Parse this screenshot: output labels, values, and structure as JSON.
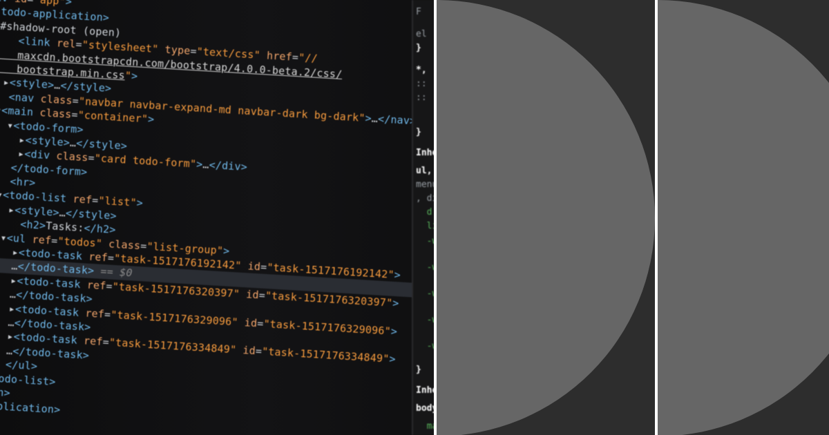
{
  "code_lines": [
    {
      "parts": [
        {
          "c": "t",
          "s": "iv "
        },
        {
          "c": "a",
          "s": "id"
        },
        {
          "c": "p",
          "s": "="
        },
        {
          "c": "v",
          "s": "\"app\""
        },
        {
          "c": "t",
          "s": ">"
        }
      ]
    },
    {
      "parts": [
        {
          "c": "t",
          "s": " todo-application>"
        }
      ]
    },
    {
      "parts": [
        {
          "c": "p",
          "s": "▾#shadow-root (open)"
        }
      ]
    },
    {
      "parts": [
        {
          "c": "t",
          "s": "    <link "
        },
        {
          "c": "a",
          "s": "rel"
        },
        {
          "c": "p",
          "s": "="
        },
        {
          "c": "v",
          "s": "\"stylesheet\""
        },
        {
          "c": "a",
          "s": " type"
        },
        {
          "c": "p",
          "s": "="
        },
        {
          "c": "v",
          "s": "\"text/css\""
        },
        {
          "c": "a",
          "s": " href"
        },
        {
          "c": "p",
          "s": "="
        },
        {
          "c": "v",
          "s": "\"//"
        }
      ]
    },
    {
      "parts": [
        {
          "c": "u",
          "s": "    maxcdn.bootstrapcdn.com/bootstrap/4.0.0-beta.2/css/"
        }
      ]
    },
    {
      "parts": [
        {
          "c": "u",
          "s": "    bootstrap.min.css"
        },
        {
          "c": "v",
          "s": "\""
        },
        {
          "c": "t",
          "s": ">"
        }
      ]
    },
    {
      "parts": [
        {
          "c": "p",
          "s": "  ▸"
        },
        {
          "c": "t",
          "s": "<style>"
        },
        {
          "c": "p",
          "s": "…"
        },
        {
          "c": "t",
          "s": "</style>"
        }
      ]
    },
    {
      "parts": [
        {
          "c": "t",
          "s": "   <nav "
        },
        {
          "c": "a",
          "s": "class"
        },
        {
          "c": "p",
          "s": "="
        },
        {
          "c": "v",
          "s": "\"navbar navbar-expand-md navbar-dark bg-dark\""
        },
        {
          "c": "t",
          "s": ">"
        },
        {
          "c": "p",
          "s": "…"
        },
        {
          "c": "t",
          "s": "</nav>"
        }
      ]
    },
    {
      "parts": [
        {
          "c": "p",
          "s": " ▾"
        },
        {
          "c": "t",
          "s": "<main "
        },
        {
          "c": "a",
          "s": "class"
        },
        {
          "c": "p",
          "s": "="
        },
        {
          "c": "v",
          "s": "\"container\""
        },
        {
          "c": "t",
          "s": ">"
        }
      ]
    },
    {
      "parts": [
        {
          "c": "p",
          "s": "   ▾"
        },
        {
          "c": "t",
          "s": "<todo-form>"
        }
      ]
    },
    {
      "parts": [
        {
          "c": "p",
          "s": "     ▸"
        },
        {
          "c": "t",
          "s": "<style>"
        },
        {
          "c": "p",
          "s": "…"
        },
        {
          "c": "t",
          "s": "</style>"
        }
      ]
    },
    {
      "parts": [
        {
          "c": "p",
          "s": "     ▸"
        },
        {
          "c": "t",
          "s": "<div "
        },
        {
          "c": "a",
          "s": "class"
        },
        {
          "c": "p",
          "s": "="
        },
        {
          "c": "v",
          "s": "\"card todo-form\""
        },
        {
          "c": "t",
          "s": ">"
        },
        {
          "c": "p",
          "s": "…"
        },
        {
          "c": "t",
          "s": "</div>"
        }
      ]
    },
    {
      "parts": [
        {
          "c": "t",
          "s": "    </todo-form>"
        }
      ]
    },
    {
      "parts": [
        {
          "c": "t",
          "s": "    <hr>"
        }
      ]
    },
    {
      "parts": [
        {
          "c": "p",
          "s": "  ▾"
        },
        {
          "c": "t",
          "s": "<todo-list "
        },
        {
          "c": "a",
          "s": "ref"
        },
        {
          "c": "p",
          "s": "="
        },
        {
          "c": "v",
          "s": "\"list\""
        },
        {
          "c": "t",
          "s": ">"
        }
      ]
    },
    {
      "parts": [
        {
          "c": "p",
          "s": "    ▸"
        },
        {
          "c": "t",
          "s": "<style>"
        },
        {
          "c": "p",
          "s": "…"
        },
        {
          "c": "t",
          "s": "</style>"
        }
      ]
    },
    {
      "parts": [
        {
          "c": "t",
          "s": "      <h2>"
        },
        {
          "c": "p",
          "s": "Tasks:"
        },
        {
          "c": "t",
          "s": "</h2>"
        }
      ]
    },
    {
      "parts": [
        {
          "c": "p",
          "s": "   ▾"
        },
        {
          "c": "t",
          "s": "<ul "
        },
        {
          "c": "a",
          "s": "ref"
        },
        {
          "c": "p",
          "s": "="
        },
        {
          "c": "v",
          "s": "\"todos\""
        },
        {
          "c": "a",
          "s": " class"
        },
        {
          "c": "p",
          "s": "="
        },
        {
          "c": "v",
          "s": "\"list-group\""
        },
        {
          "c": "t",
          "s": ">"
        }
      ]
    },
    {
      "parts": [
        {
          "c": "p",
          "s": "     ▸"
        },
        {
          "c": "t",
          "s": "<todo-task "
        },
        {
          "c": "a",
          "s": "ref"
        },
        {
          "c": "p",
          "s": "="
        },
        {
          "c": "v",
          "s": "\"task-1517176192142\""
        },
        {
          "c": "a",
          "s": " id"
        },
        {
          "c": "p",
          "s": "="
        },
        {
          "c": "v",
          "s": "\"task-1517176192142\""
        },
        {
          "c": "t",
          "s": ">"
        }
      ]
    },
    {
      "sel": true,
      "parts": [
        {
          "c": "p",
          "s": "     …"
        },
        {
          "c": "t",
          "s": "</todo-task>"
        },
        {
          "c": "c",
          "s": " == $0"
        }
      ]
    },
    {
      "parts": [
        {
          "c": "p",
          "s": "     ▸"
        },
        {
          "c": "t",
          "s": "<todo-task "
        },
        {
          "c": "a",
          "s": "ref"
        },
        {
          "c": "p",
          "s": "="
        },
        {
          "c": "v",
          "s": "\"task-1517176320397\""
        },
        {
          "c": "a",
          "s": " id"
        },
        {
          "c": "p",
          "s": "="
        },
        {
          "c": "v",
          "s": "\"task-1517176320397\""
        },
        {
          "c": "t",
          "s": ">"
        }
      ]
    },
    {
      "parts": [
        {
          "c": "p",
          "s": "     …"
        },
        {
          "c": "t",
          "s": "</todo-task>"
        }
      ]
    },
    {
      "parts": [
        {
          "c": "p",
          "s": "     ▸"
        },
        {
          "c": "t",
          "s": "<todo-task "
        },
        {
          "c": "a",
          "s": "ref"
        },
        {
          "c": "p",
          "s": "="
        },
        {
          "c": "v",
          "s": "\"task-1517176329096\""
        },
        {
          "c": "a",
          "s": " id"
        },
        {
          "c": "p",
          "s": "="
        },
        {
          "c": "v",
          "s": "\"task-1517176329096\""
        },
        {
          "c": "t",
          "s": ">"
        }
      ]
    },
    {
      "parts": [
        {
          "c": "p",
          "s": "     …"
        },
        {
          "c": "t",
          "s": "</todo-task>"
        }
      ]
    },
    {
      "parts": [
        {
          "c": "p",
          "s": "     ▸"
        },
        {
          "c": "t",
          "s": "<todo-task "
        },
        {
          "c": "a",
          "s": "ref"
        },
        {
          "c": "p",
          "s": "="
        },
        {
          "c": "v",
          "s": "\"task-1517176334849\""
        },
        {
          "c": "a",
          "s": " id"
        },
        {
          "c": "p",
          "s": "="
        },
        {
          "c": "v",
          "s": "\"task-1517176334849\""
        },
        {
          "c": "t",
          "s": ">"
        }
      ]
    },
    {
      "parts": [
        {
          "c": "p",
          "s": "     …"
        },
        {
          "c": "t",
          "s": "</todo-task>"
        }
      ]
    },
    {
      "parts": [
        {
          "c": "t",
          "s": "     </ul>"
        }
      ]
    },
    {
      "parts": [
        {
          "c": "t",
          "s": "    odo-list>"
        }
      ]
    },
    {
      "parts": [
        {
          "c": "t",
          "s": "    n>"
        }
      ]
    },
    {
      "parts": [
        {
          "c": "t",
          "s": "    plication>"
        }
      ]
    }
  ],
  "side_panel": [
    {
      "cls": "",
      "text": "F"
    },
    {
      "cls": "",
      "text": "el"
    },
    {
      "cls": "w",
      "text": "}"
    },
    {
      "cls": "w",
      "text": "*,"
    },
    {
      "cls": "",
      "text": "::"
    },
    {
      "cls": "",
      "text": "::"
    },
    {
      "cls": "w",
      "text": "}"
    },
    {
      "cls": "w",
      "text": "Inhe"
    },
    {
      "cls": "w",
      "text": "ul,"
    },
    {
      "cls": "",
      "text": "menu"
    },
    {
      "cls": "",
      "text": ", di"
    },
    {
      "cls": "g",
      "text": "  d"
    },
    {
      "cls": "g",
      "text": "  li"
    },
    {
      "cls": "g",
      "text": "  -w"
    },
    {
      "cls": "g",
      "text": "  -w"
    },
    {
      "cls": "g",
      "text": "  -w"
    },
    {
      "cls": "g",
      "text": "  -w"
    },
    {
      "cls": "g",
      "text": "  -we"
    },
    {
      "cls": "w",
      "text": "}"
    },
    {
      "cls": "w",
      "text": "Inherite"
    },
    {
      "cls": "w",
      "text": "body {"
    },
    {
      "cls": "g",
      "text": "  marg"
    }
  ],
  "colors": {
    "panel_bg": "#2d2d2d",
    "half_circle": "#666666",
    "divider": "#ffffff"
  }
}
